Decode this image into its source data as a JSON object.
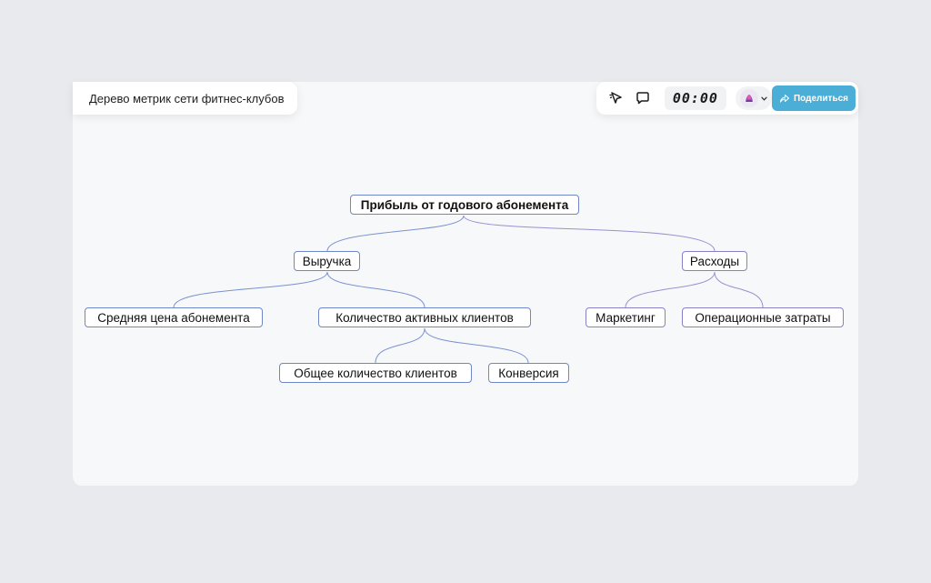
{
  "board": {
    "title": "Дерево метрик сети фитнес-клубов"
  },
  "toolbar": {
    "timer": "00:00",
    "share_label": "Поделиться",
    "icons": [
      "cursor-sparkle-icon",
      "comment-icon",
      "avatar-icon",
      "chevron-down-icon",
      "share-arrow-icon"
    ],
    "share_color": "#4aaed6"
  },
  "diagram": {
    "accent_left": "#6f87c7",
    "accent_right": "#8a80c8",
    "nodes": {
      "root": "Прибыль от годового абонемента",
      "revenue": "Выручка",
      "expenses": "Расходы",
      "avg_price": "Средняя цена абонемента",
      "active_clients": "Количество активных клиентов",
      "marketing": "Маркетинг",
      "operating": "Операционные затраты",
      "total_clients": "Общее количество клиентов",
      "conversion": "Конверсия"
    }
  }
}
